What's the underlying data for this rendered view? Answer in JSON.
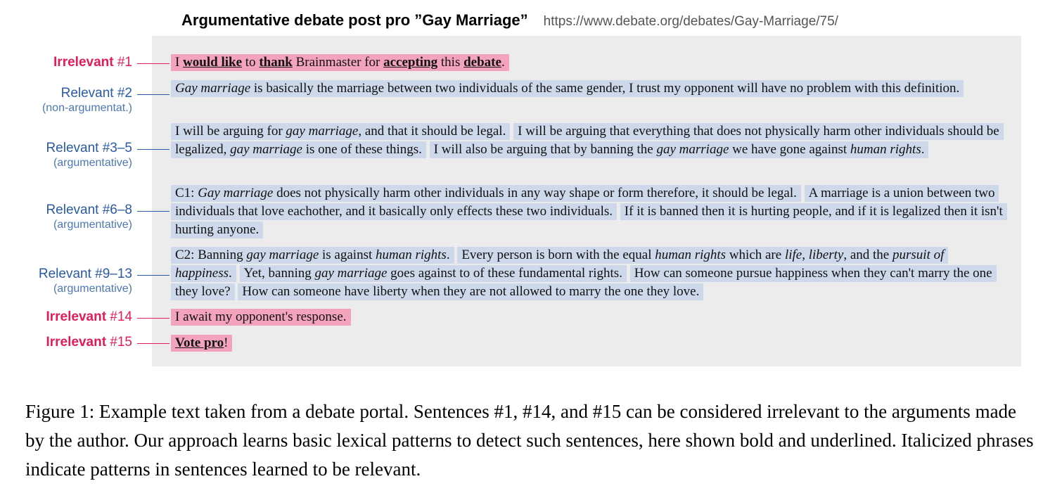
{
  "header": {
    "title": "Argumentative debate post pro ”Gay Marriage”",
    "url": "https://www.debate.org/debates/Gay-Marriage/75/"
  },
  "labels": {
    "l1": {
      "word": "Irrelevant",
      "num": "#1"
    },
    "l2": {
      "text": "Relevant #2",
      "sub": "(non-argumentat.)"
    },
    "l3": {
      "text": "Relevant #3–5",
      "sub": "(argumentative)"
    },
    "l4": {
      "text": "Relevant #6–8",
      "sub": "(argumentative)"
    },
    "l5": {
      "text": "Relevant #9–13",
      "sub": "(argumentative)"
    },
    "l6": {
      "word": "Irrelevant",
      "num": "#14"
    },
    "l7": {
      "word": "Irrelevant",
      "num": "#15"
    }
  },
  "sentences": {
    "s1": {
      "a": "I ",
      "b": "would like",
      "c": " to ",
      "d": "thank",
      "e": " Brainmaster for ",
      "f": "accepting",
      "g": " this ",
      "h": "debate",
      "i": "."
    },
    "s2": {
      "a": "Gay marriage",
      "b": " is basically the marriage between two individuals of the same gender, I trust my opponent will have no problem with this definition."
    },
    "s3": {
      "a": "I will be arguing for ",
      "b": "gay marriage",
      "c": ", and that it should be legal."
    },
    "s4": {
      "a": "I will be arguing that everything that does not physically harm other individuals should be legalized, ",
      "b": "gay marriage",
      "c": " is one of these things."
    },
    "s5": {
      "a": "I will also be arguing that by banning the ",
      "b": "gay marriage",
      "c": " we have gone against ",
      "d": "human rights",
      "e": "."
    },
    "s6": {
      "a": "C1: ",
      "b": "Gay marriage",
      "c": " does not physically harm other individuals in any way shape or form therefore, it should be legal."
    },
    "s7": {
      "a": "A marriage is a union between two individuals that love eachother, and it basically only effects these two individuals."
    },
    "s8": {
      "a": "If it is banned then it is hurting people, and if it is legalized then it isn't hurting anyone."
    },
    "s9": {
      "a": "C2: Banning ",
      "b": "gay marriage",
      "c": " is against ",
      "d": "human rights",
      "e": "."
    },
    "s10": {
      "a": "Every person is born with the equal ",
      "b": "human rights",
      "c": " which are ",
      "d": "life, liberty",
      "e": ", and the ",
      "f": "pursuit of happiness",
      "g": "."
    },
    "s11": {
      "a": "Yet, banning ",
      "b": "gay marriage",
      "c": " goes against to of these fundamental rights."
    },
    "s12": {
      "a": "How can someone pursue happiness when they can't marry the one they love?"
    },
    "s13": {
      "a": "How can someone have liberty when they are not allowed to marry the one they love."
    },
    "s14": {
      "a": "I await my opponent's response."
    },
    "s15": {
      "a": "Vote pro",
      "b": "!"
    }
  },
  "caption": "Figure 1: Example text taken from a debate portal. Sentences #1, #14, and #15 can be considered irrelevant to the arguments made by the author. Our approach learns basic lexical patterns to detect such sentences, here shown bold and underlined. Italicized phrases indicate patterns in sentences learned to be relevant.",
  "colors": {
    "irrelevant": "#e41c56",
    "relevant": "#2a5aa7",
    "irrelevant_highlight": "#f3a3bc",
    "relevant_highlight": "#cdd8ea",
    "panel": "#ececec"
  }
}
